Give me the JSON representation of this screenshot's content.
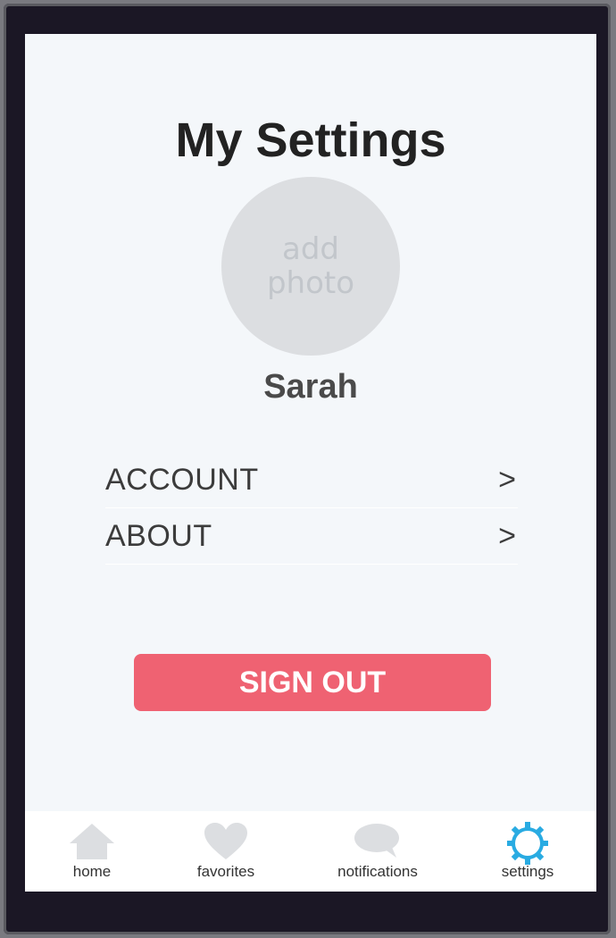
{
  "header": {
    "title": "My Settings"
  },
  "profile": {
    "avatar_text": "add photo",
    "name": "Sarah"
  },
  "menu": {
    "items": [
      {
        "label": "ACCOUNT",
        "chevron": ">"
      },
      {
        "label": "ABOUT",
        "chevron": ">"
      }
    ]
  },
  "actions": {
    "sign_out": "SIGN OUT"
  },
  "tabbar": {
    "tabs": [
      {
        "label": "home",
        "icon": "home-icon",
        "active": false
      },
      {
        "label": "favorites",
        "icon": "heart-icon",
        "active": false
      },
      {
        "label": "notifications",
        "icon": "chat-bubble-icon",
        "active": false
      },
      {
        "label": "settings",
        "icon": "gear-icon",
        "active": true
      }
    ]
  },
  "colors": {
    "accent": "#29abe2",
    "danger": "#ef6272",
    "inactive_icon": "#dcdee1",
    "background": "#f4f7fa"
  }
}
